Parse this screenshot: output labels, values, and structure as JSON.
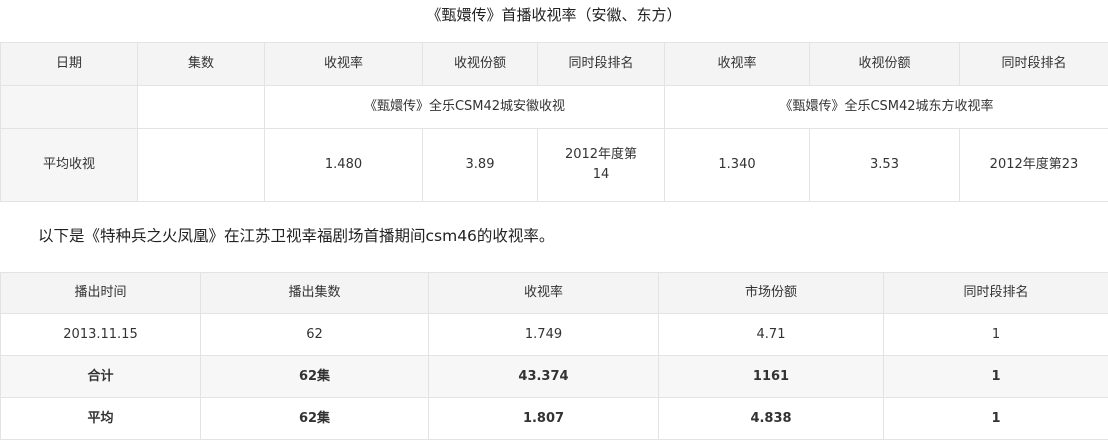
{
  "title": "《甄嬛传》首播收视率（安徽、东方）",
  "table1": {
    "headers": [
      "日期",
      "集数",
      "收视率",
      "收视份额",
      "同时段排名",
      "收视率",
      "收视份额",
      "同时段排名"
    ],
    "subheaders": [
      "《甄嬛传》全乐CSM42城安徽收视",
      "《甄嬛传》全乐CSM42城东方收视率"
    ],
    "avg_row": [
      "平均收视",
      "",
      "1.480",
      "3.89",
      "2012年度第14",
      "1.340",
      "3.53",
      "2012年度第23"
    ]
  },
  "note": "以下是《特种兵之火凤凰》在江苏卫视幸福剧场首播期间csm46的收视率。",
  "table2": {
    "headers": [
      "播出时间",
      "播出集数",
      "收视率",
      "市场份额",
      "同时段排名"
    ],
    "rows": [
      [
        "2013.11.15",
        "62",
        "1.749",
        "4.71",
        "1"
      ],
      [
        "合计",
        "62集",
        "43.374",
        "1161",
        "1"
      ],
      [
        "平均",
        "62集",
        "1.807",
        "4.838",
        "1"
      ]
    ]
  }
}
